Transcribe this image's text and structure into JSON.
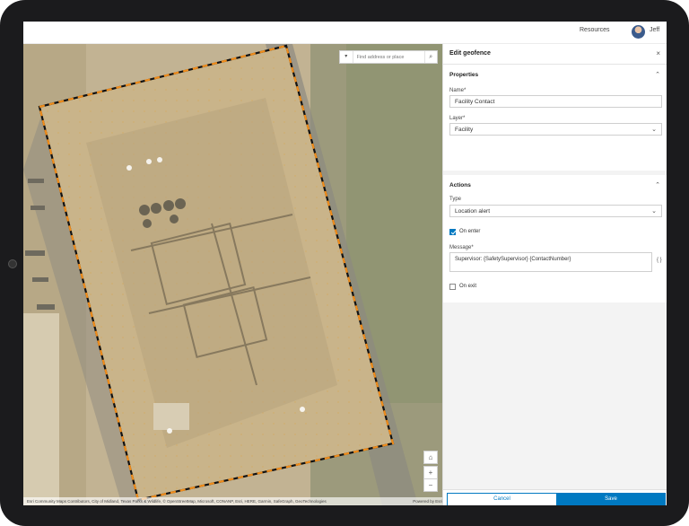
{
  "topbar": {
    "resources_label": "Resources",
    "user_name": "Jeff"
  },
  "map": {
    "search_placeholder": "Find address or place",
    "attribution": "Esri Community Maps Contributors, City of Midland, Texas Parks & Wildlife, © OpenStreetMap, Microsoft, CONANP, Esri, HERE, Garmin, SafeGraph, GeoTechnologies",
    "powered_by": "Powered by Esri",
    "geofence_color": "#f08c1a",
    "zoom_in": "+",
    "zoom_out": "−"
  },
  "panel": {
    "title": "Edit geofence",
    "properties": {
      "section_title": "Properties",
      "name_label": "Name*",
      "name_value": "Facility Contact",
      "layer_label": "Layer*",
      "layer_value": "Facility"
    },
    "actions": {
      "section_title": "Actions",
      "type_label": "Type",
      "type_value": "Location alert",
      "on_enter_label": "On enter",
      "on_enter_checked": true,
      "message_label": "Message*",
      "message_value": "Supervisor: {SafetySupervisor} {ContactNumber}",
      "braces": "{ }",
      "on_exit_label": "On exit",
      "on_exit_checked": false
    },
    "cancel_label": "Cancel",
    "save_label": "Save",
    "accent_color": "#0079c1"
  }
}
